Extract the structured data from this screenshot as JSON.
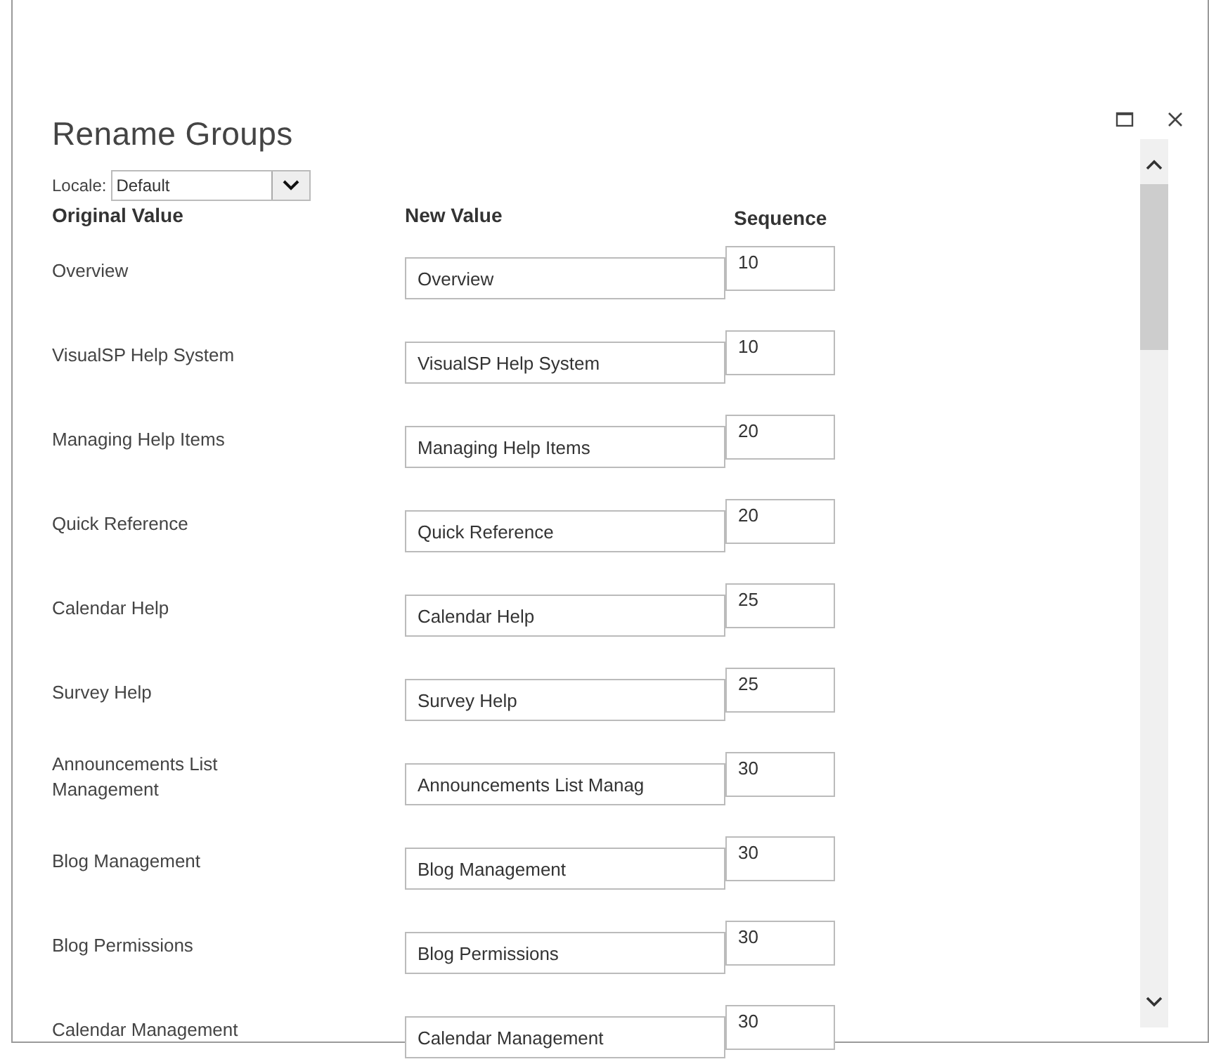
{
  "window": {
    "title": "Rename Groups"
  },
  "locale": {
    "label": "Locale:",
    "value": "Default"
  },
  "columns": [
    "Original Value",
    "New Value",
    "Sequence"
  ],
  "rows": [
    {
      "original": "Overview",
      "new_value": "Overview",
      "sequence": "10"
    },
    {
      "original": "VisualSP Help System",
      "new_value": "VisualSP Help System",
      "sequence": "10"
    },
    {
      "original": "Managing Help Items",
      "new_value": "Managing Help Items",
      "sequence": "20"
    },
    {
      "original": "Quick Reference",
      "new_value": "Quick Reference",
      "sequence": "20"
    },
    {
      "original": "Calendar Help",
      "new_value": "Calendar Help",
      "sequence": "25"
    },
    {
      "original": "Survey Help",
      "new_value": "Survey Help",
      "sequence": "25"
    },
    {
      "original": "Announcements List Management",
      "new_value": "Announcements List Manag",
      "sequence": "30"
    },
    {
      "original": "Blog Management",
      "new_value": "Blog Management",
      "sequence": "30"
    },
    {
      "original": "Blog Permissions",
      "new_value": "Blog Permissions",
      "sequence": "30"
    },
    {
      "original": "Calendar Management",
      "new_value": "Calendar Management",
      "sequence": "30"
    }
  ]
}
